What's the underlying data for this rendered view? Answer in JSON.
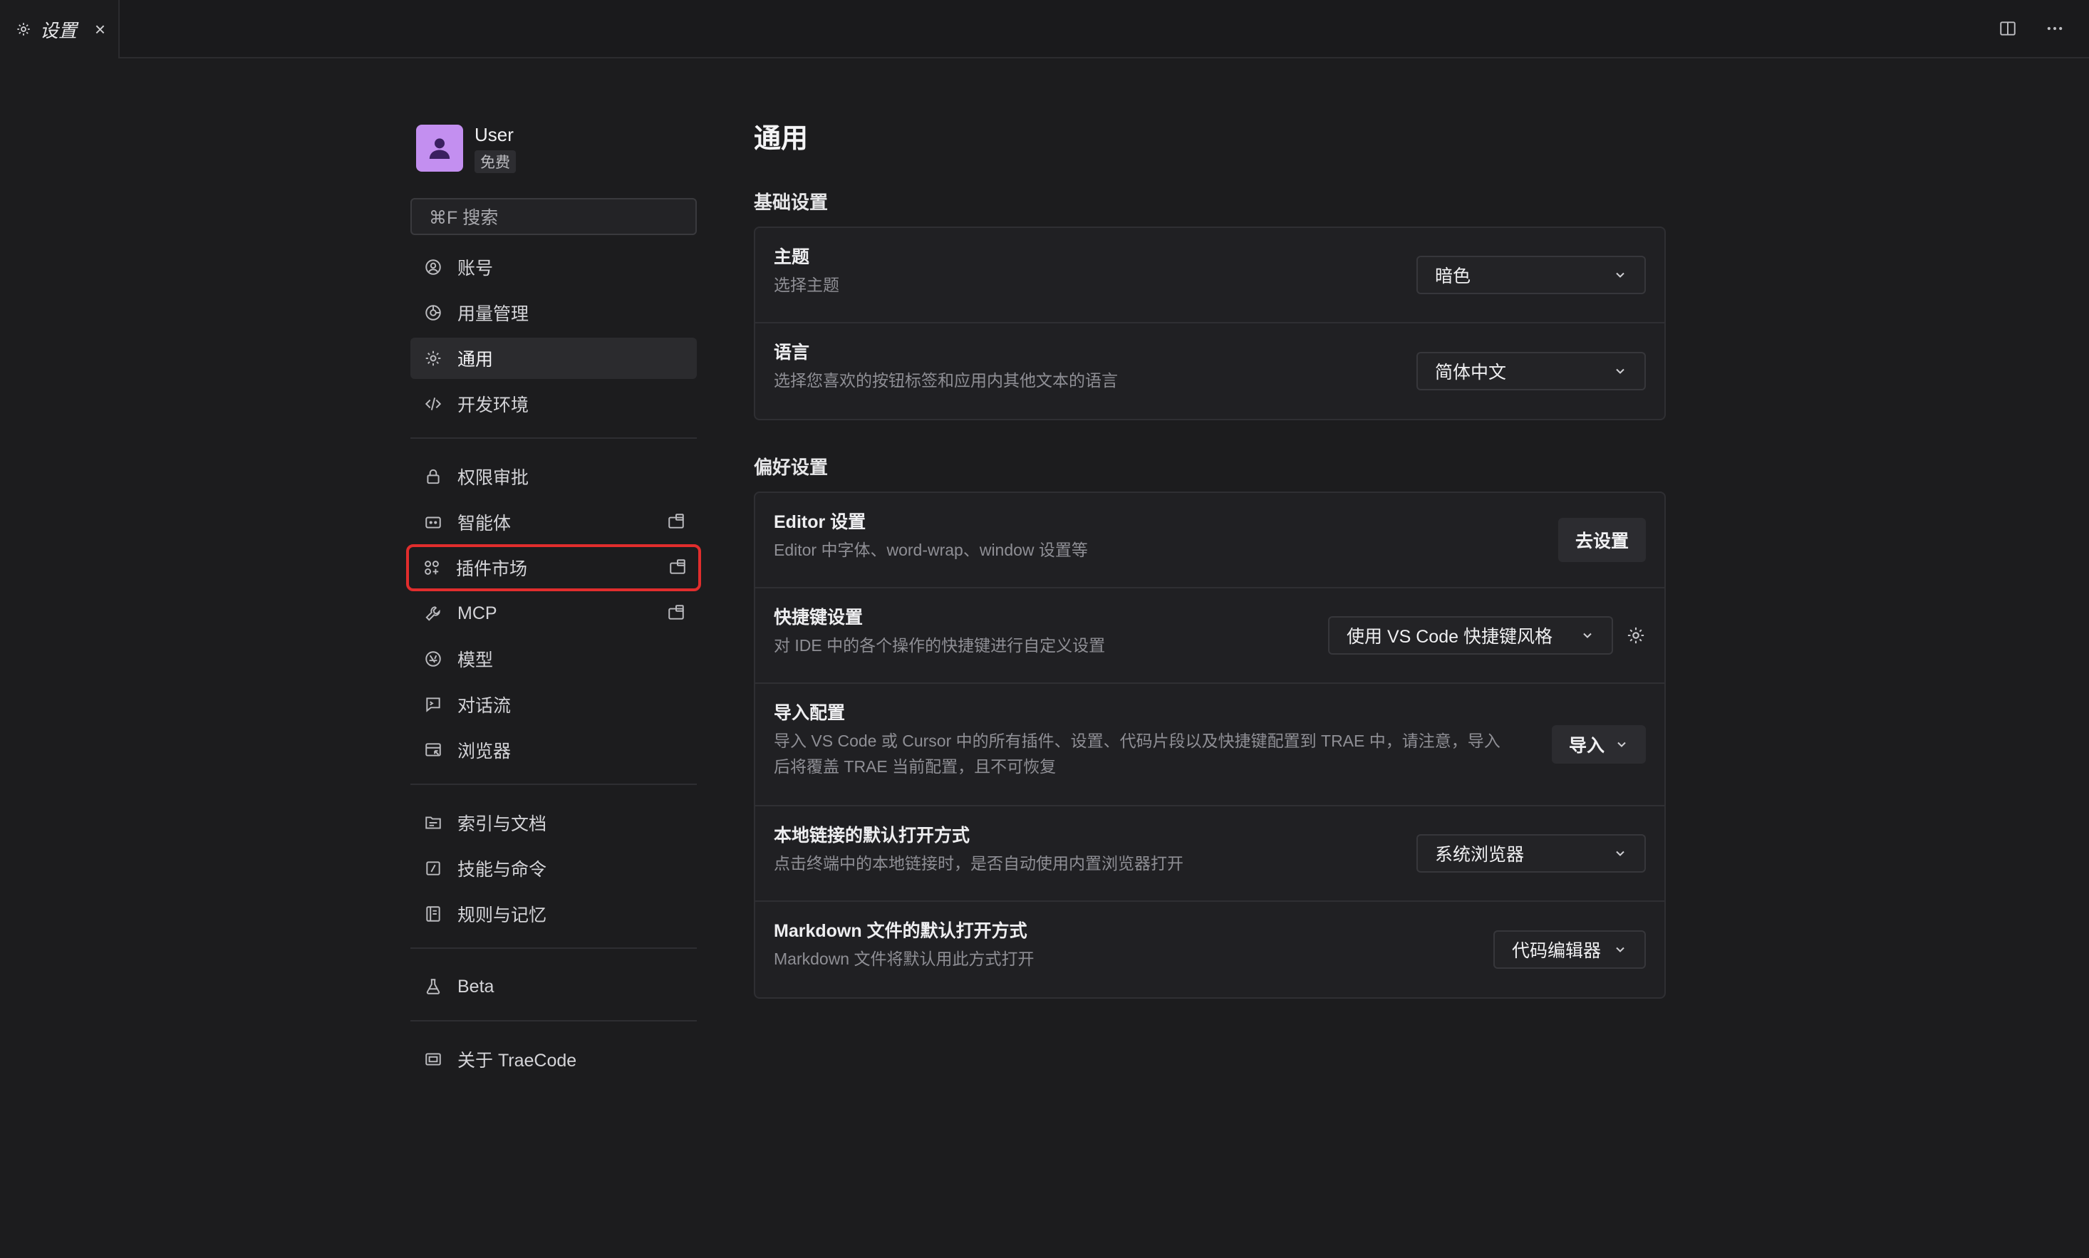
{
  "tab": {
    "title": "设置",
    "close": "×"
  },
  "user": {
    "name": "User",
    "plan": "免费"
  },
  "search": {
    "placeholder": "⌘F 搜索"
  },
  "nav": {
    "group1": [
      {
        "label": "账号",
        "icon": "account-icon"
      },
      {
        "label": "用量管理",
        "icon": "usage-icon"
      },
      {
        "label": "通用",
        "icon": "gear-icon",
        "active": true
      },
      {
        "label": "开发环境",
        "icon": "code-icon"
      }
    ],
    "group2": [
      {
        "label": "权限审批",
        "icon": "lock-icon"
      },
      {
        "label": "智能体",
        "icon": "agent-icon",
        "external": true
      },
      {
        "label": "插件市场",
        "icon": "plugins-icon",
        "external": true,
        "highlighted": true
      },
      {
        "label": "MCP",
        "icon": "wrench-icon",
        "external": true
      },
      {
        "label": "模型",
        "icon": "model-icon"
      },
      {
        "label": "对话流",
        "icon": "chat-flow-icon"
      },
      {
        "label": "浏览器",
        "icon": "browser-icon"
      }
    ],
    "group3": [
      {
        "label": "索引与文档",
        "icon": "index-icon"
      },
      {
        "label": "技能与命令",
        "icon": "command-icon"
      },
      {
        "label": "规则与记忆",
        "icon": "rules-icon"
      }
    ],
    "group4": [
      {
        "label": "Beta",
        "icon": "flask-icon"
      }
    ],
    "group5": [
      {
        "label": "关于 TraeCode",
        "icon": "about-icon"
      }
    ]
  },
  "main": {
    "title": "通用",
    "basic": {
      "title": "基础设置",
      "theme": {
        "title": "主题",
        "desc": "选择主题",
        "value": "暗色"
      },
      "language": {
        "title": "语言",
        "desc": "选择您喜欢的按钮标签和应用内其他文本的语言",
        "value": "简体中文"
      }
    },
    "prefs": {
      "title": "偏好设置",
      "editor": {
        "title": "Editor 设置",
        "desc": "Editor 中字体、word-wrap、window 设置等",
        "button": "去设置"
      },
      "keybind": {
        "title": "快捷键设置",
        "desc": "对 IDE 中的各个操作的快捷键进行自定义设置",
        "value": "使用 VS Code 快捷键风格"
      },
      "import": {
        "title": "导入配置",
        "desc": "导入 VS Code 或 Cursor 中的所有插件、设置、代码片段以及快捷键配置到 TRAE 中，请注意，导入后将覆盖 TRAE 当前配置，且不可恢复",
        "button": "导入"
      },
      "local_link": {
        "title": "本地链接的默认打开方式",
        "desc": "点击终端中的本地链接时，是否自动使用内置浏览器打开",
        "value": "系统浏览器"
      },
      "markdown": {
        "title": "Markdown 文件的默认打开方式",
        "desc": "Markdown 文件将默认用此方式打开",
        "value": "代码编辑器"
      }
    }
  },
  "colors": {
    "background": "#1c1c1e",
    "highlight": "#e12d2d",
    "avatar": "#c38ff0"
  }
}
